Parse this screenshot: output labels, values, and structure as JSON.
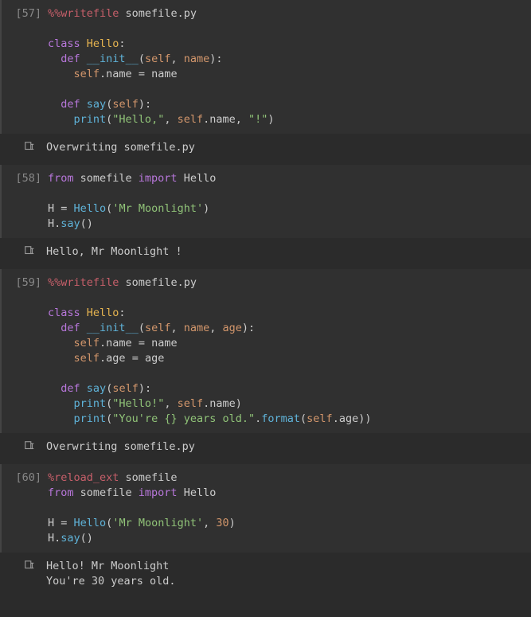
{
  "cells": [
    {
      "prompt": "[57]",
      "code": [
        {
          "t": "magic",
          "v": "%%writefile"
        },
        {
          "t": "plain",
          "v": " "
        },
        {
          "t": "file",
          "v": "somefile.py"
        },
        {
          "t": "nl"
        },
        {
          "t": "nl"
        },
        {
          "t": "kw",
          "v": "class"
        },
        {
          "t": "plain",
          "v": " "
        },
        {
          "t": "name",
          "v": "Hello"
        },
        {
          "t": "punc",
          "v": ":"
        },
        {
          "t": "nl"
        },
        {
          "t": "plain",
          "v": "  "
        },
        {
          "t": "kw",
          "v": "def"
        },
        {
          "t": "plain",
          "v": " "
        },
        {
          "t": "fn",
          "v": "__init__"
        },
        {
          "t": "punc",
          "v": "("
        },
        {
          "t": "param",
          "v": "self"
        },
        {
          "t": "punc",
          "v": ", "
        },
        {
          "t": "param",
          "v": "name"
        },
        {
          "t": "punc",
          "v": "):"
        },
        {
          "t": "nl"
        },
        {
          "t": "plain",
          "v": "    "
        },
        {
          "t": "param",
          "v": "self"
        },
        {
          "t": "punc",
          "v": "."
        },
        {
          "t": "plain",
          "v": "name"
        },
        {
          "t": "punc",
          "v": " = "
        },
        {
          "t": "plain",
          "v": "name"
        },
        {
          "t": "nl"
        },
        {
          "t": "nl"
        },
        {
          "t": "plain",
          "v": "  "
        },
        {
          "t": "kw",
          "v": "def"
        },
        {
          "t": "plain",
          "v": " "
        },
        {
          "t": "fn",
          "v": "say"
        },
        {
          "t": "punc",
          "v": "("
        },
        {
          "t": "param",
          "v": "self"
        },
        {
          "t": "punc",
          "v": "):"
        },
        {
          "t": "nl"
        },
        {
          "t": "plain",
          "v": "    "
        },
        {
          "t": "fn",
          "v": "print"
        },
        {
          "t": "punc",
          "v": "("
        },
        {
          "t": "str",
          "v": "\"Hello,\""
        },
        {
          "t": "punc",
          "v": ", "
        },
        {
          "t": "param",
          "v": "self"
        },
        {
          "t": "punc",
          "v": "."
        },
        {
          "t": "plain",
          "v": "name"
        },
        {
          "t": "punc",
          "v": ", "
        },
        {
          "t": "str",
          "v": "\"!\""
        },
        {
          "t": "punc",
          "v": ")"
        }
      ],
      "output": "Overwriting somefile.py"
    },
    {
      "prompt": "[58]",
      "code": [
        {
          "t": "kw",
          "v": "from"
        },
        {
          "t": "plain",
          "v": " somefile "
        },
        {
          "t": "kw",
          "v": "import"
        },
        {
          "t": "plain",
          "v": " Hello"
        },
        {
          "t": "nl"
        },
        {
          "t": "nl"
        },
        {
          "t": "plain",
          "v": "H "
        },
        {
          "t": "punc",
          "v": "= "
        },
        {
          "t": "fn",
          "v": "Hello"
        },
        {
          "t": "punc",
          "v": "("
        },
        {
          "t": "str",
          "v": "'Mr Moonlight'"
        },
        {
          "t": "punc",
          "v": ")"
        },
        {
          "t": "nl"
        },
        {
          "t": "plain",
          "v": "H"
        },
        {
          "t": "punc",
          "v": "."
        },
        {
          "t": "fn",
          "v": "say"
        },
        {
          "t": "punc",
          "v": "()"
        }
      ],
      "output": "Hello, Mr Moonlight !"
    },
    {
      "prompt": "[59]",
      "code": [
        {
          "t": "magic",
          "v": "%%writefile"
        },
        {
          "t": "plain",
          "v": " "
        },
        {
          "t": "file",
          "v": "somefile.py"
        },
        {
          "t": "nl"
        },
        {
          "t": "nl"
        },
        {
          "t": "kw",
          "v": "class"
        },
        {
          "t": "plain",
          "v": " "
        },
        {
          "t": "name",
          "v": "Hello"
        },
        {
          "t": "punc",
          "v": ":"
        },
        {
          "t": "nl"
        },
        {
          "t": "plain",
          "v": "  "
        },
        {
          "t": "kw",
          "v": "def"
        },
        {
          "t": "plain",
          "v": " "
        },
        {
          "t": "fn",
          "v": "__init__"
        },
        {
          "t": "punc",
          "v": "("
        },
        {
          "t": "param",
          "v": "self"
        },
        {
          "t": "punc",
          "v": ", "
        },
        {
          "t": "param",
          "v": "name"
        },
        {
          "t": "punc",
          "v": ", "
        },
        {
          "t": "param",
          "v": "age"
        },
        {
          "t": "punc",
          "v": "):"
        },
        {
          "t": "nl"
        },
        {
          "t": "plain",
          "v": "    "
        },
        {
          "t": "param",
          "v": "self"
        },
        {
          "t": "punc",
          "v": "."
        },
        {
          "t": "plain",
          "v": "name"
        },
        {
          "t": "punc",
          "v": " = "
        },
        {
          "t": "plain",
          "v": "name"
        },
        {
          "t": "nl"
        },
        {
          "t": "plain",
          "v": "    "
        },
        {
          "t": "param",
          "v": "self"
        },
        {
          "t": "punc",
          "v": "."
        },
        {
          "t": "plain",
          "v": "age"
        },
        {
          "t": "punc",
          "v": " = "
        },
        {
          "t": "plain",
          "v": "age"
        },
        {
          "t": "nl"
        },
        {
          "t": "nl"
        },
        {
          "t": "plain",
          "v": "  "
        },
        {
          "t": "kw",
          "v": "def"
        },
        {
          "t": "plain",
          "v": " "
        },
        {
          "t": "fn",
          "v": "say"
        },
        {
          "t": "punc",
          "v": "("
        },
        {
          "t": "param",
          "v": "self"
        },
        {
          "t": "punc",
          "v": "):"
        },
        {
          "t": "nl"
        },
        {
          "t": "plain",
          "v": "    "
        },
        {
          "t": "fn",
          "v": "print"
        },
        {
          "t": "punc",
          "v": "("
        },
        {
          "t": "str",
          "v": "\"Hello!\""
        },
        {
          "t": "punc",
          "v": ", "
        },
        {
          "t": "param",
          "v": "self"
        },
        {
          "t": "punc",
          "v": "."
        },
        {
          "t": "plain",
          "v": "name"
        },
        {
          "t": "punc",
          "v": ")"
        },
        {
          "t": "nl"
        },
        {
          "t": "plain",
          "v": "    "
        },
        {
          "t": "fn",
          "v": "print"
        },
        {
          "t": "punc",
          "v": "("
        },
        {
          "t": "str",
          "v": "\"You're {} years old.\""
        },
        {
          "t": "punc",
          "v": "."
        },
        {
          "t": "fn",
          "v": "format"
        },
        {
          "t": "punc",
          "v": "("
        },
        {
          "t": "param",
          "v": "self"
        },
        {
          "t": "punc",
          "v": "."
        },
        {
          "t": "plain",
          "v": "age"
        },
        {
          "t": "punc",
          "v": "))"
        }
      ],
      "output": "Overwriting somefile.py"
    },
    {
      "prompt": "[60]",
      "code": [
        {
          "t": "magic",
          "v": "%reload_ext"
        },
        {
          "t": "plain",
          "v": " somefile"
        },
        {
          "t": "nl"
        },
        {
          "t": "kw",
          "v": "from"
        },
        {
          "t": "plain",
          "v": " somefile "
        },
        {
          "t": "kw",
          "v": "import"
        },
        {
          "t": "plain",
          "v": " Hello"
        },
        {
          "t": "nl"
        },
        {
          "t": "nl"
        },
        {
          "t": "plain",
          "v": "H "
        },
        {
          "t": "punc",
          "v": "= "
        },
        {
          "t": "fn",
          "v": "Hello"
        },
        {
          "t": "punc",
          "v": "("
        },
        {
          "t": "str",
          "v": "'Mr Moonlight'"
        },
        {
          "t": "punc",
          "v": ", "
        },
        {
          "t": "num",
          "v": "30"
        },
        {
          "t": "punc",
          "v": ")"
        },
        {
          "t": "nl"
        },
        {
          "t": "plain",
          "v": "H"
        },
        {
          "t": "punc",
          "v": "."
        },
        {
          "t": "fn",
          "v": "say"
        },
        {
          "t": "punc",
          "v": "()"
        }
      ],
      "output": "Hello! Mr Moonlight\nYou're 30 years old."
    }
  ]
}
